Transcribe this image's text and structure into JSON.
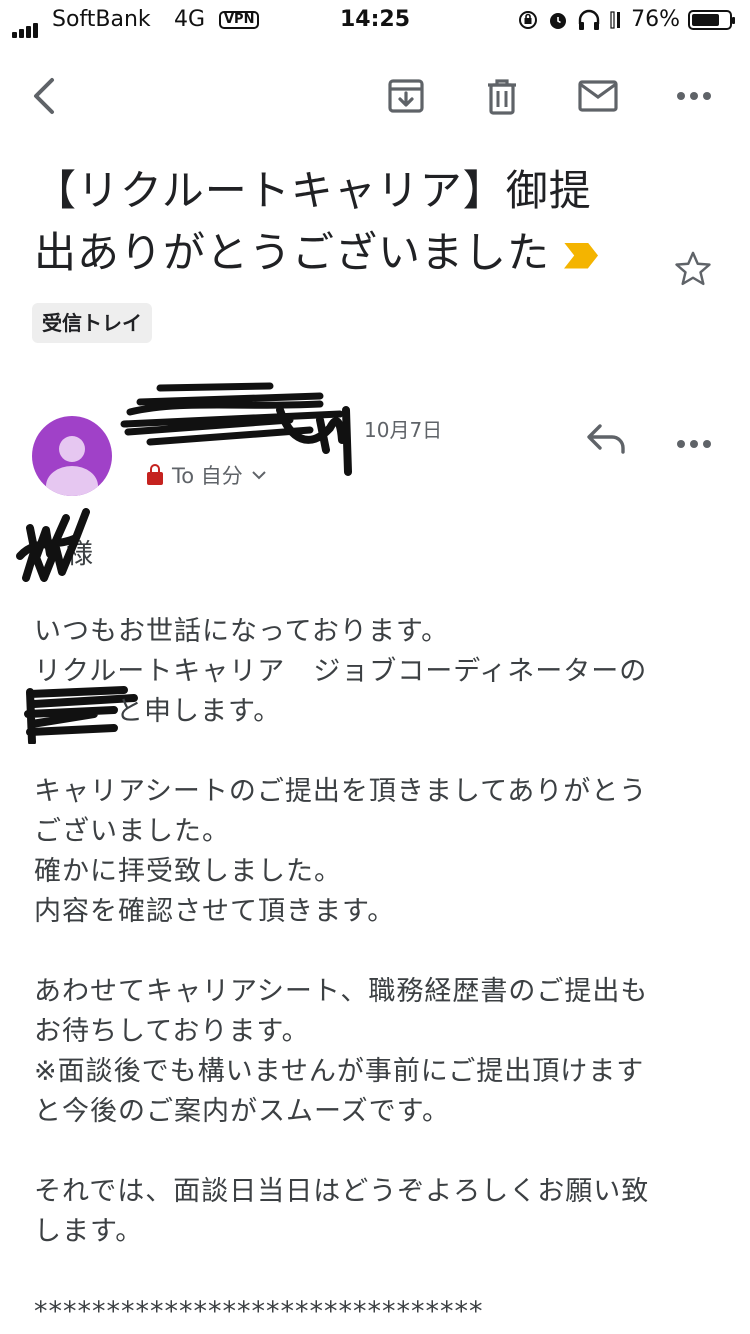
{
  "status_bar": {
    "carrier": "SoftBank",
    "network": "4G",
    "vpn": "VPN",
    "time": "14:25",
    "battery": "76%",
    "battery_level": 0.76
  },
  "toolbar": {
    "back_icon": "back-arrow-icon",
    "archive_icon": "archive-icon",
    "delete_icon": "trash-icon",
    "unread_icon": "mail-icon",
    "more_icon": "more-horizontal-icon"
  },
  "email": {
    "subject_line1": "【リクルートキャリア】御提",
    "subject_line2": "出ありがとうございました",
    "label": "受信トレイ",
    "date": "10月7日",
    "to": "To 自分",
    "salutation": "様",
    "body": [
      "いつもお世話になっております。",
      "リクルートキャリア　ジョブコーディネーターの",
      "と申します。",
      "",
      "キャリアシートのご提出を頂きましてありがとう",
      "ございました。",
      "確かに拝受致しました。",
      "内容を確認させて頂きます。",
      "",
      "あわせてキャリアシート、職務経歴書のご提出も",
      "お待ちしております。",
      "※面談後でも構いませんが事前にご提出頂けます",
      "と今後のご案内がスムーズです。",
      "",
      "それでは、面談日当日はどうぞよろしくお願い致",
      "します。",
      "",
      "*******************************"
    ]
  },
  "colors": {
    "avatar": "#a041c8",
    "importance": "#f4b400",
    "label_bg": "#eeeeee"
  }
}
